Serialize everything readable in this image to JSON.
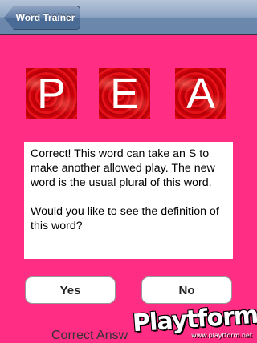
{
  "navbar": {
    "back_label": "Word Trainer"
  },
  "tiles": [
    {
      "letter": "P"
    },
    {
      "letter": "E"
    },
    {
      "letter": "A"
    }
  ],
  "message": {
    "paragraph1": "Correct! This word can take an S to make another allowed play. The new word is the usual plural of this word.",
    "paragraph2": "Would you like to see the definition of this word?"
  },
  "buttons": {
    "yes_label": "Yes",
    "no_label": "No"
  },
  "footer": {
    "correct_answers_label": "Correct Answ"
  },
  "watermark": {
    "brand": "Playtform",
    "url": "www.playtform.net"
  },
  "colors": {
    "background": "#ff2d83",
    "tile": "#d10a12",
    "navbar": "#6d88ad"
  }
}
